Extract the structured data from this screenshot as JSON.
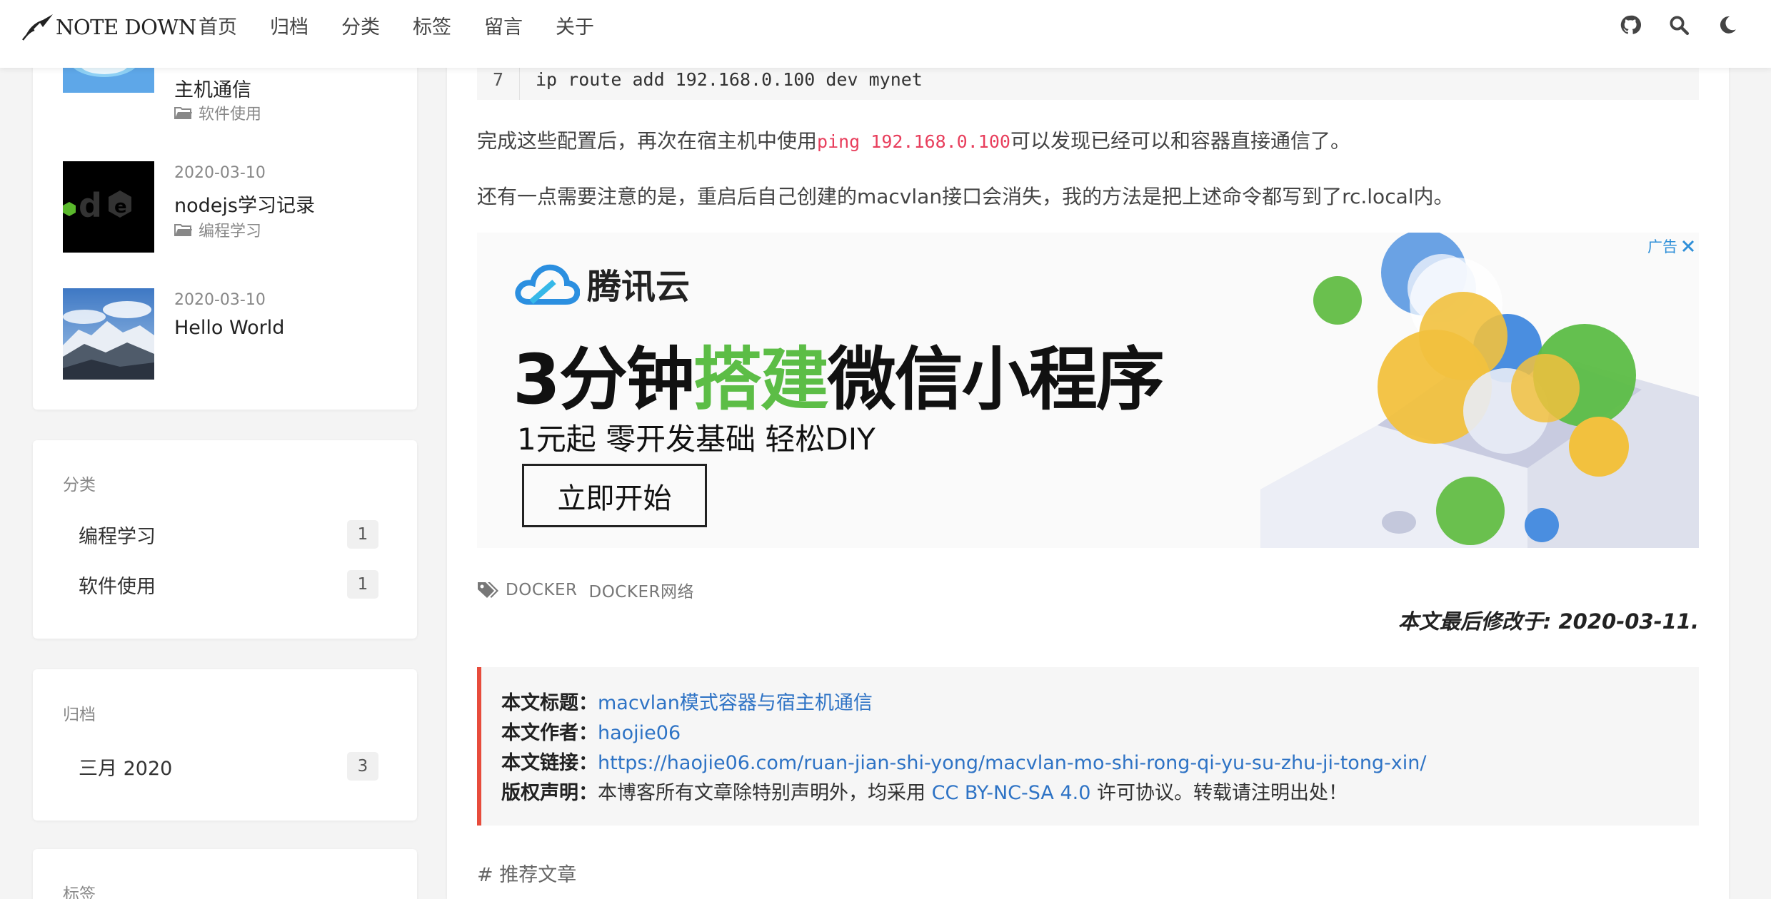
{
  "header": {
    "logo_text": "NOTE DOWN",
    "nav": [
      "首页",
      "归档",
      "分类",
      "标签",
      "留言",
      "关于"
    ]
  },
  "sidebar": {
    "recent_posts": [
      {
        "title": "主机通信",
        "category": "软件使用"
      },
      {
        "date": "2020-03-10",
        "title": "nodejs学习记录",
        "category": "编程学习"
      },
      {
        "date": "2020-03-10",
        "title": "Hello World"
      }
    ],
    "categories": {
      "title": "分类",
      "items": [
        {
          "label": "编程学习",
          "count": "1"
        },
        {
          "label": "软件使用",
          "count": "1"
        }
      ]
    },
    "archives": {
      "title": "归档",
      "items": [
        {
          "label": "三月 2020",
          "count": "3"
        }
      ]
    },
    "tags_title": "标签"
  },
  "article": {
    "code_line_number": "7",
    "code_line": "ip route add 192.168.0.100 dev mynet",
    "para1_before": "完成这些配置后，再次在宿主机中使用",
    "para1_code": "ping 192.168.0.100",
    "para1_after": "可以发现已经可以和容器直接通信了。",
    "para2": "还有一点需要注意的是，重启后自己创建的macvlan接口会消失，我的方法是把上述命令都写到了rc.local内。",
    "ad": {
      "label": "广告",
      "brand": "腾讯云",
      "headline_pre": "3分钟",
      "headline_hl": "搭建",
      "headline_post": "微信小程序",
      "sub": "1元起  零开发基础  轻松DIY",
      "button": "立即开始"
    },
    "tags": [
      "DOCKER",
      "DOCKER网络"
    ],
    "last_modified": "本文最后修改于: 2020-03-11.",
    "copyright": {
      "title_label": "本文标题：",
      "title_value": "macvlan模式容器与宿主机通信",
      "author_label": "本文作者：",
      "author_value": "haojie06",
      "link_label": "本文链接：",
      "link_value": "https://haojie06.com/ruan-jian-shi-yong/macvlan-mo-shi-rong-qi-yu-su-zhu-ji-tong-xin/",
      "license_label": "版权声明：",
      "license_before": "本博客所有文章除特别声明外，均采用 ",
      "license_link": "CC BY-NC-SA 4.0",
      "license_after": " 许可协议。转载请注明出处！"
    },
    "recommend_title": "# 推荐文章"
  },
  "colors": {
    "accent_red": "#e74c3c",
    "link_blue": "#2e73c5",
    "inline_code": "#e83e5c",
    "ad_green": "#5cbd46"
  },
  "icons": [
    "github-icon",
    "search-icon",
    "moon-icon",
    "folder-icon",
    "tags-icon",
    "close-icon"
  ]
}
